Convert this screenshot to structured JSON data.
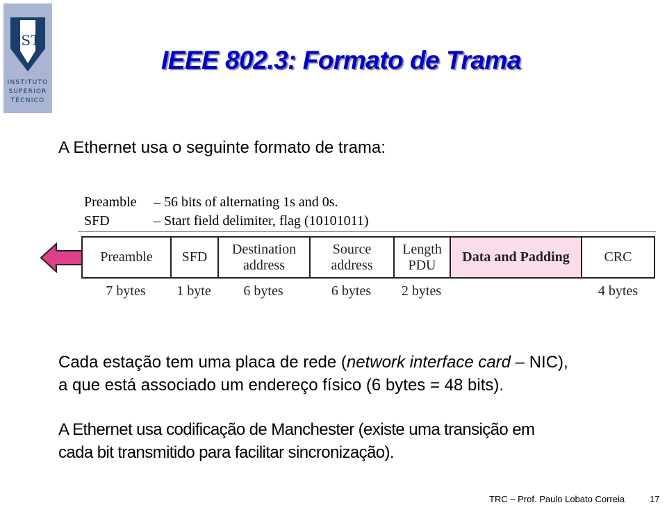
{
  "logo": {
    "icon": "ist-shield-logo",
    "lines": [
      "INSTITUTO",
      "SUPERIOR",
      "TÉCNICO"
    ],
    "bg_color": "#a9b5d3",
    "shield_color": "#1b3f6b"
  },
  "title": "IEEE 802.3: Formato de Trama",
  "title_color": "#0000cc",
  "intro": "A Ethernet usa o seguinte formato de trama:",
  "legend": [
    {
      "term": "Preamble",
      "definition": "– 56 bits of alternating 1s and 0s."
    },
    {
      "term": "SFD",
      "definition": "– Start field delimiter, flag (10101011)"
    }
  ],
  "frame": {
    "direction_icon": "left-arrow-icon",
    "arrow_color": "#e0408a",
    "highlight_color": "#fbdcec",
    "fields": [
      {
        "label_lines": [
          "Preamble"
        ],
        "size": "7 bytes"
      },
      {
        "label_lines": [
          "SFD"
        ],
        "size": "1 byte"
      },
      {
        "label_lines": [
          "Destination",
          "address"
        ],
        "size": "6 bytes"
      },
      {
        "label_lines": [
          "Source",
          "address"
        ],
        "size": "6 bytes"
      },
      {
        "label_lines": [
          "Length",
          "PDU"
        ],
        "size": "2 bytes"
      },
      {
        "label_lines": [
          "Data and Padding"
        ],
        "size": "",
        "highlight": true
      },
      {
        "label_lines": [
          "CRC"
        ],
        "size": "4 bytes"
      }
    ]
  },
  "paragraph1": {
    "line1_before": "Cada estação tem uma placa de rede (",
    "line1_italic": "network interface card",
    "line1_after": " – NIC),",
    "line2": "a que está associado um endereço físico (6 bytes = 48 bits)."
  },
  "paragraph2": {
    "line1": "A Ethernet usa codificação de Manchester (existe uma transição em",
    "line2": "cada bit transmitido para facilitar sincronização)."
  },
  "footer": {
    "text": "TRC – Prof. Paulo Lobato Correia",
    "page_number": "17"
  }
}
